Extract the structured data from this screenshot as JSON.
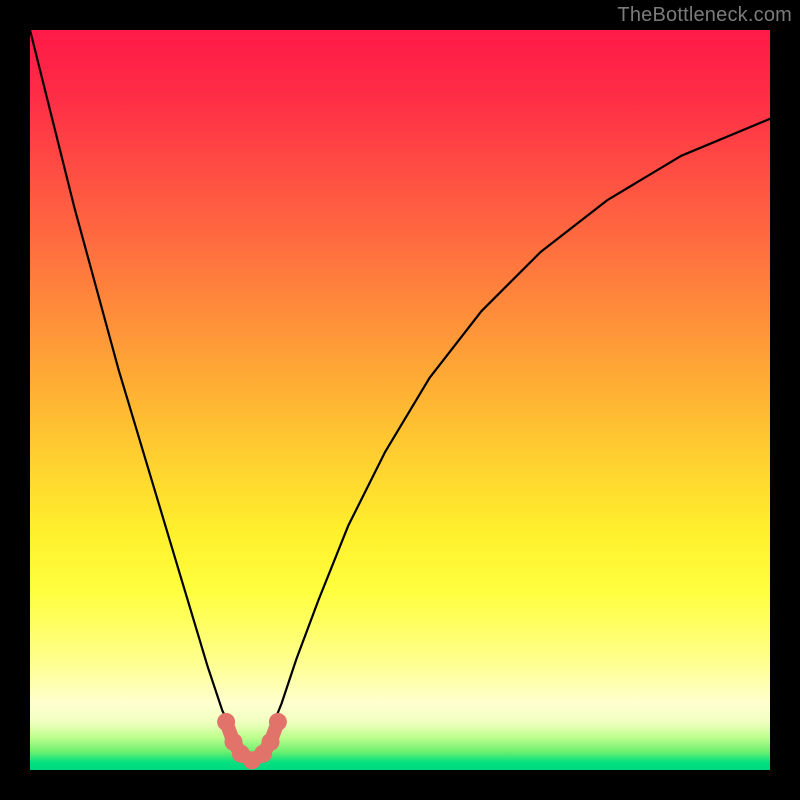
{
  "watermark": "TheBottleneck.com",
  "chart_data": {
    "type": "line",
    "title": "",
    "xlabel": "",
    "ylabel": "",
    "xlim": [
      0,
      100
    ],
    "ylim": [
      0,
      100
    ],
    "grid": false,
    "legend": false,
    "background_gradient": [
      "#ff1a48",
      "#00d880"
    ],
    "series": [
      {
        "name": "bottleneck-curve",
        "x": [
          0,
          3,
          6,
          9,
          12,
          15,
          18,
          21,
          24,
          26,
          28,
          29,
          30,
          31,
          32,
          34,
          36,
          39,
          43,
          48,
          54,
          61,
          69,
          78,
          88,
          100
        ],
        "y": [
          100,
          88,
          76,
          65,
          54,
          44,
          34,
          24,
          14,
          8,
          4,
          2,
          1.3,
          2,
          4,
          9,
          15,
          23,
          33,
          43,
          53,
          62,
          70,
          77,
          83,
          88
        ]
      }
    ],
    "markers": {
      "name": "valley-markers",
      "x": [
        26.5,
        27.5,
        28.5,
        30,
        31.5,
        32.5,
        33.5
      ],
      "y": [
        6.5,
        3.8,
        2.2,
        1.3,
        2.2,
        3.8,
        6.5
      ]
    }
  }
}
